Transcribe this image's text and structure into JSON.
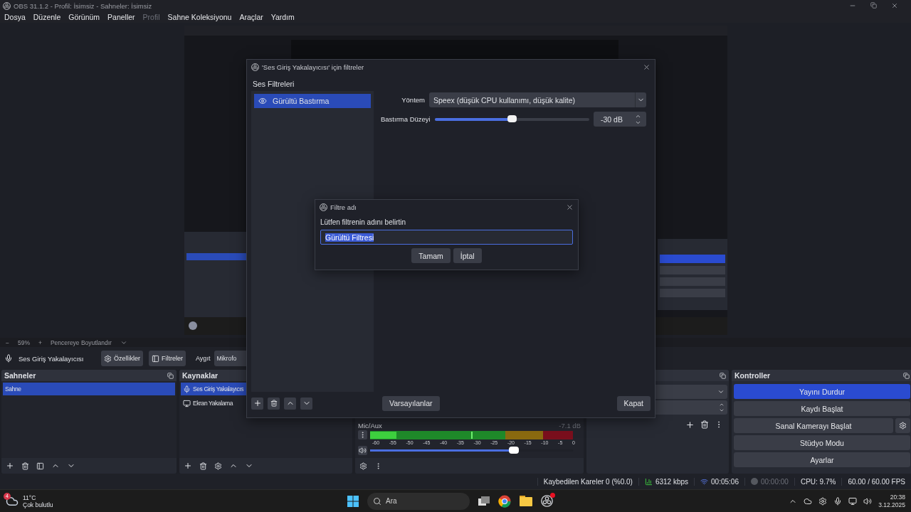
{
  "window": {
    "title": "OBS 31.1.2 - Profil: İsimsiz - Sahneler: İsimsiz"
  },
  "menu": [
    {
      "label": "Dosya",
      "disabled": false
    },
    {
      "label": "Düzenle",
      "disabled": false
    },
    {
      "label": "Görünüm",
      "disabled": false
    },
    {
      "label": "Paneller",
      "disabled": false
    },
    {
      "label": "Profil",
      "disabled": true
    },
    {
      "label": "Sahne Koleksiyonu",
      "disabled": false
    },
    {
      "label": "Araçlar",
      "disabled": false
    },
    {
      "label": "Yardım",
      "disabled": false
    }
  ],
  "zoom_bar": {
    "minus": "−",
    "zoom": "59%",
    "plus": "+",
    "fit": "Pencereye Boyutlandır"
  },
  "source_toolbar": {
    "source": "Ses Giriş Yakalayıcısı",
    "properties": "Özellikler",
    "filters": "Filtreler",
    "device_label": "Aygıt",
    "device": "Mikrofo"
  },
  "scenes": {
    "title": "Sahneler",
    "items": [
      {
        "label": "Sahne",
        "selected": true
      }
    ]
  },
  "sources": {
    "title": "Kaynaklar",
    "items": [
      {
        "label": "Ses Giriş Yakalayıcıs",
        "kind": "mic",
        "selected": true
      },
      {
        "label": "Ekran Yakalama",
        "kind": "screen",
        "selected": false
      }
    ]
  },
  "mixer": {
    "channel": "Mic/Aux",
    "reading": "-7.1 dB",
    "scale": [
      "-60",
      "-55",
      "-50",
      "-45",
      "-40",
      "-35",
      "-30",
      "-25",
      "-20",
      "-15",
      "-10",
      "-5",
      "0"
    ],
    "level": 0.71
  },
  "controls": {
    "title": "Kontroller",
    "buttons": [
      {
        "label": "Yayını Durdur",
        "active": true,
        "kind": "plain"
      },
      {
        "label": "Kaydı Başlat",
        "active": false,
        "kind": "plain"
      },
      {
        "label": "Sanal Kamerayı Başlat",
        "active": false,
        "kind": "gear"
      },
      {
        "label": "Stüdyo Modu",
        "active": false,
        "kind": "plain"
      },
      {
        "label": "Ayarlar",
        "active": false,
        "kind": "plain"
      }
    ]
  },
  "status_bar": {
    "dropped": "Kaybedilen Kareler 0 (%0.0)",
    "bitrate": "6312 kbps",
    "stream_time": "00:05:06",
    "record_time": "00:00:00",
    "cpu": "CPU: 9.7%",
    "fps": "60.00 / 60.00 FPS"
  },
  "filters_dialog": {
    "title": "'Ses Giriş Yakalayıcısı' için filtreler",
    "section": "Ses Filtreleri",
    "filters": [
      {
        "label": "Gürültü Bastırma",
        "visible": true,
        "selected": true
      }
    ],
    "method_label": "Yöntem",
    "method": "Speex (düşük CPU kullanımı, düşük kalite)",
    "level_label": "Bastırma Düzeyi",
    "level": 0.5,
    "level_value": "-30 dB",
    "defaults": "Varsayılanlar",
    "close": "Kapat"
  },
  "name_dialog": {
    "title": "Filtre adı",
    "prompt": "Lütfen filtrenin adını belirtin",
    "value": "Gürültü Filtresi",
    "ok": "Tamam",
    "cancel": "İptal"
  },
  "taskbar": {
    "badge": "4",
    "temperature": "11°C",
    "weather": "Çok bulutlu",
    "search": "Ara",
    "time": "20:38",
    "date": "3.12.2025"
  }
}
